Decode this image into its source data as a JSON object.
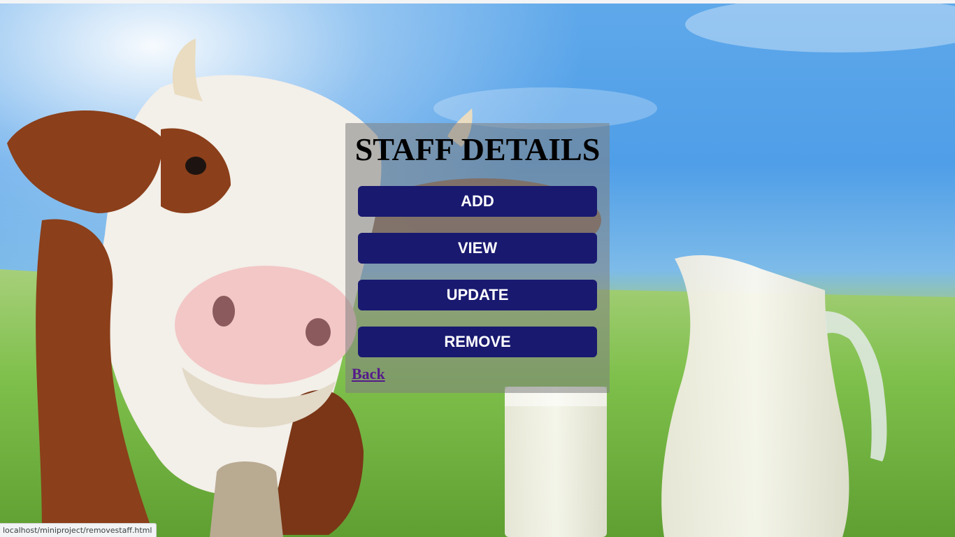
{
  "page": {
    "title": "STAFF DETAILS"
  },
  "menu": {
    "add_label": "ADD",
    "view_label": "VIEW",
    "update_label": "UPDATE",
    "remove_label": "REMOVE"
  },
  "back_link": {
    "label": "Back"
  },
  "status_bar": {
    "url": "localhost/miniproject/removestaff.html"
  },
  "colors": {
    "button_bg": "#191970",
    "button_text": "#ffffff",
    "panel_bg": "rgba(128,128,128,0.55)",
    "link": "#551a8b"
  },
  "background": {
    "image": "cow-and-milk-photo"
  }
}
